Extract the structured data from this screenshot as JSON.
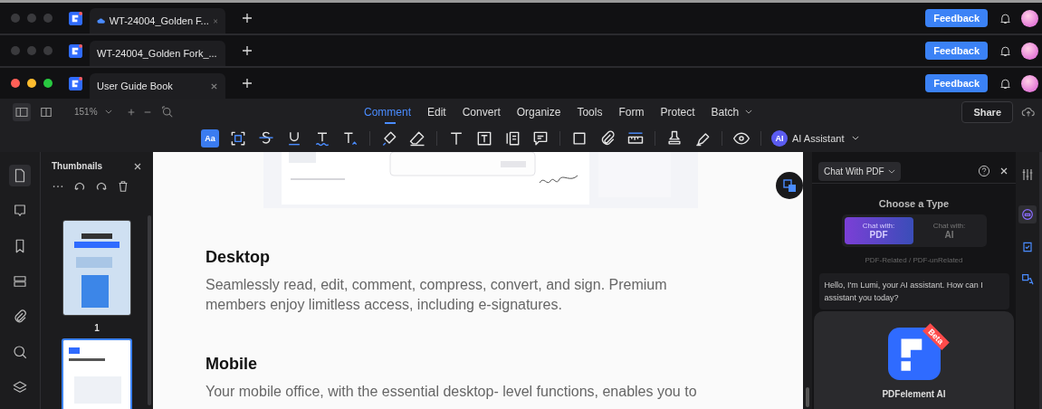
{
  "windows": [
    {
      "tab_title": "WT-24004_Golden F...",
      "cloud": true,
      "focused": false,
      "feedback": "Feedback"
    },
    {
      "tab_title": "WT-24004_Golden Fork_...",
      "cloud": false,
      "focused": false,
      "feedback": "Feedback"
    },
    {
      "tab_title": "User Guide Book",
      "cloud": false,
      "focused": true,
      "feedback": "Feedback"
    }
  ],
  "toolbar": {
    "zoom": "151%",
    "menus": [
      {
        "label": "Comment",
        "selected": true,
        "dropdown": false
      },
      {
        "label": "Edit",
        "selected": false,
        "dropdown": false
      },
      {
        "label": "Convert",
        "selected": false,
        "dropdown": false
      },
      {
        "label": "Organize",
        "selected": false,
        "dropdown": false
      },
      {
        "label": "Tools",
        "selected": false,
        "dropdown": false
      },
      {
        "label": "Form",
        "selected": false,
        "dropdown": false
      },
      {
        "label": "Protect",
        "selected": false,
        "dropdown": false
      },
      {
        "label": "Batch",
        "selected": false,
        "dropdown": true
      }
    ],
    "share": "Share",
    "tool_groups": [
      [
        {
          "kind": "text-style",
          "label": "Aa",
          "selected": true
        },
        {
          "kind": "area-select",
          "selected": false
        },
        {
          "kind": "strikethrough",
          "selected": false
        },
        {
          "kind": "underline",
          "selected": false
        },
        {
          "kind": "squiggly",
          "selected": false
        },
        {
          "kind": "caret",
          "selected": false
        }
      ],
      [
        {
          "kind": "highlighter",
          "selected": false
        },
        {
          "kind": "eraser",
          "selected": false
        }
      ],
      [
        {
          "kind": "text",
          "selected": false
        },
        {
          "kind": "textbox",
          "selected": false
        },
        {
          "kind": "callout",
          "selected": false
        },
        {
          "kind": "note",
          "selected": false
        }
      ],
      [
        {
          "kind": "rectangle",
          "selected": false
        },
        {
          "kind": "paperclip",
          "selected": false
        },
        {
          "kind": "ruler",
          "selected": false
        }
      ],
      [
        {
          "kind": "stamp",
          "selected": false
        },
        {
          "kind": "signature",
          "selected": false
        }
      ],
      [
        {
          "kind": "eye",
          "selected": false
        }
      ]
    ],
    "ai_badge": "AI",
    "ai_assistant": "AI Assistant"
  },
  "left_rail": [
    {
      "kind": "page",
      "selected": true
    },
    {
      "kind": "comment",
      "selected": false
    },
    {
      "kind": "bookmark",
      "selected": false
    },
    {
      "kind": "stack",
      "selected": false
    },
    {
      "kind": "paperclip",
      "selected": false
    },
    {
      "kind": "search",
      "selected": false
    },
    {
      "kind": "layers",
      "selected": false
    }
  ],
  "thumbnails": {
    "title": "Thumbnails",
    "pages": [
      {
        "label": "1",
        "selected": false
      },
      {
        "selected": true
      }
    ]
  },
  "document": {
    "sections": [
      {
        "heading": "Desktop",
        "body": "Seamlessly read, edit, comment, compress, convert, and sign. Premium members enjoy limitless access, including e-signatures."
      },
      {
        "heading": "Mobile",
        "body": "Your mobile office, with the essential desktop- level functions, enables you to"
      }
    ]
  },
  "chat_panel": {
    "mode": "Chat With PDF",
    "heading": "Choose a Type",
    "types": [
      {
        "line1": "Chat with:",
        "line2": "PDF",
        "selected": true
      },
      {
        "line1": "Chat with:",
        "line2": "AI",
        "selected": false
      }
    ],
    "hint": "PDF-Related / PDF-unRelated",
    "message": "Hello, I'm Lumi, your AI assistant. How can I assistant you today?",
    "card_badge": "Beta",
    "card_title": "PDFelement AI"
  },
  "right_rail": [
    {
      "kind": "sliders",
      "selected": false
    },
    {
      "kind": "robot",
      "selected": true
    },
    {
      "kind": "check",
      "selected": false
    },
    {
      "kind": "translate",
      "selected": false
    }
  ]
}
